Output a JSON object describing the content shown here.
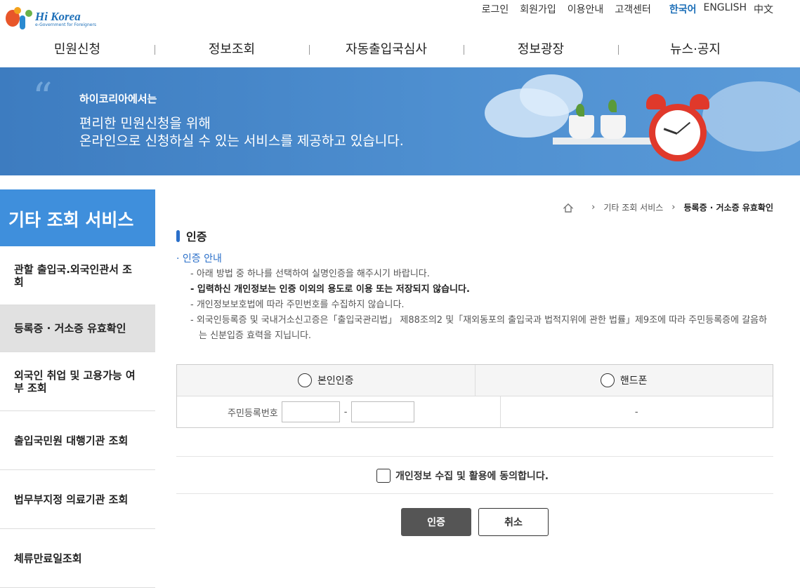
{
  "header": {
    "logo_text": "Hi Korea",
    "logo_subtext": "e-Government for Foreigners",
    "util_links": [
      "로그인",
      "회원가입",
      "이용안내",
      "고객센터"
    ],
    "languages": [
      "한국어",
      "ENGLISH",
      "中文"
    ],
    "active_language": "한국어",
    "gnb": [
      "민원신청",
      "정보조회",
      "자동출입국심사",
      "정보광장",
      "뉴스·공지"
    ]
  },
  "banner": {
    "line1": "하이코리아에서는",
    "line2": "편리한 민원신청을 위해",
    "line3": "온라인으로 신청하실 수 있는 서비스를 제공하고 있습니다."
  },
  "sidebar": {
    "title": "기타 조회 서비스",
    "items": [
      {
        "label": "관할 출입국.외국인관서 조회"
      },
      {
        "label": "등록증 · 거소증 유효확인"
      },
      {
        "label": "외국인 취업 및 고용가능 여부 조회"
      },
      {
        "label": "출입국민원 대행기관 조회"
      },
      {
        "label": "법무부지정 의료기관 조회"
      },
      {
        "label": "체류만료일조회"
      }
    ],
    "active_index": 1
  },
  "breadcrumb": [
    "기타 조회 서비스",
    "등록증 · 거소증 유효확인"
  ],
  "section_title": "인증",
  "guide": {
    "title": "인증 안내",
    "items": [
      "- 아래 방법 중 하나를 선택하여 실명인증을 해주시기 바랍니다.",
      "- 입력하신 개인정보는 인증 이외의 용도로 이용 또는 저장되지 않습니다.",
      "- 개인정보보호법에 따라 주민번호를 수집하지 않습니다.",
      "- 외국인등록증 및 국내거소신고증은「출입국관리법」 제88조의2 및「재외동포의 출입국과 법적지위에 관한 법률」제9조에 따라 주민등록증에 갈음하는 신분입증 효력을 지닙니다."
    ]
  },
  "auth": {
    "option1": "본인인증",
    "option2": "핸드폰",
    "id_label": "주민등록번호",
    "dash": "-",
    "phone_placeholder": "-"
  },
  "consent_label": "개인정보 수집 및 활용에 동의합니다.",
  "buttons": {
    "confirm": "인증",
    "cancel": "취소"
  }
}
